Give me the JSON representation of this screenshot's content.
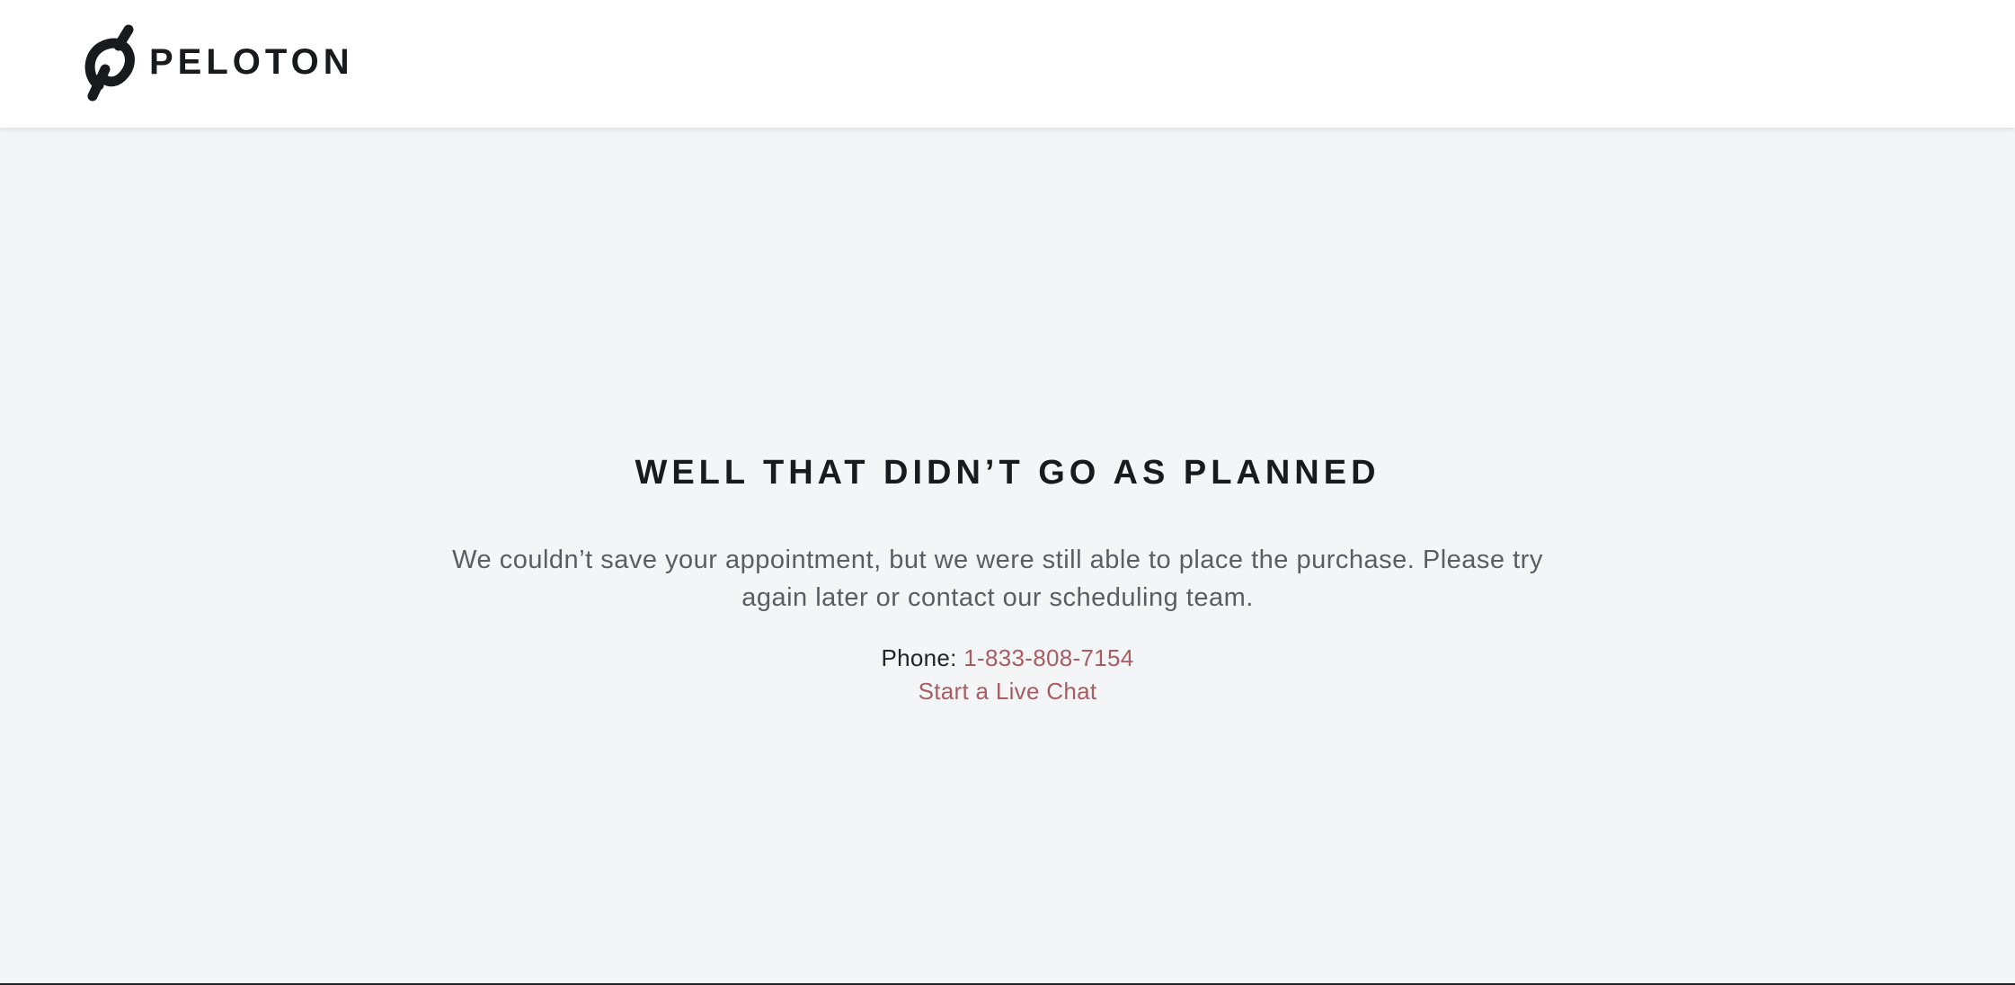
{
  "header": {
    "brand_name": "PELOTON",
    "logo_icon": "peloton-logo-icon"
  },
  "error": {
    "title": "WELL THAT DIDN’T GO AS PLANNED",
    "message": "We couldn’t save your appointment, but we were still able to place the purchase. Please try again later or contact our scheduling team.",
    "phone_label": "Phone:",
    "phone_number": "1-833-808-7154",
    "chat_link": "Start a Live Chat"
  },
  "colors": {
    "background": "#f4f5f7",
    "header_background": "#ffffff",
    "title_text": "#181a1d",
    "body_text": "#5a5d63",
    "link": "#a85d63"
  }
}
